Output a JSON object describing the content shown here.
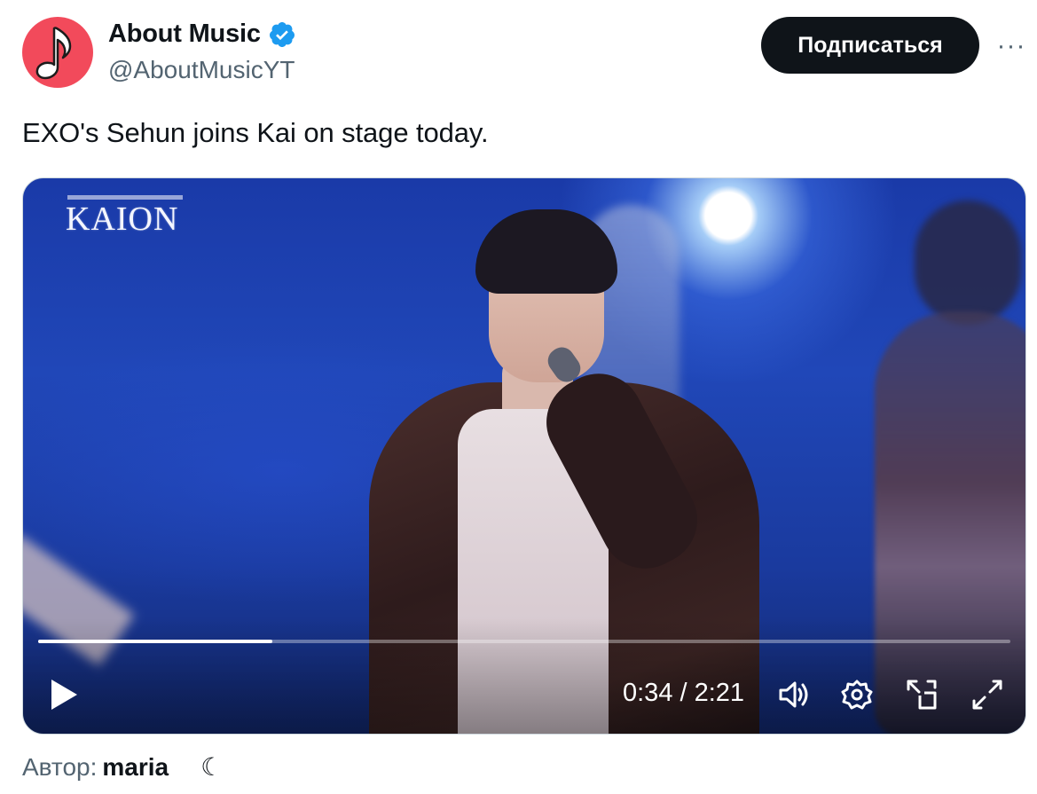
{
  "account": {
    "display_name": "About Music",
    "handle": "@AboutMusicYT",
    "avatar_icon": "music-note-icon",
    "avatar_color": "#f24a5b",
    "verified": true,
    "verified_color": "#1d9bf0"
  },
  "actions": {
    "follow_label": "Подписаться",
    "more_icon": "more-dots-icon",
    "more_label": "···"
  },
  "tweet": {
    "text": "EXO's Sehun joins Kai on stage today."
  },
  "video": {
    "watermark": "KAION",
    "current_time": "0:34",
    "duration": "2:21",
    "time_display": "0:34 / 2:21",
    "progress_fraction": 0.2411,
    "controls": [
      "play-icon",
      "volume-icon",
      "settings-gear-icon",
      "picture-in-picture-icon",
      "fullscreen-icon"
    ]
  },
  "footer": {
    "author_label": "Автор:",
    "author_name": "maria",
    "moon_glyph": "☾"
  }
}
